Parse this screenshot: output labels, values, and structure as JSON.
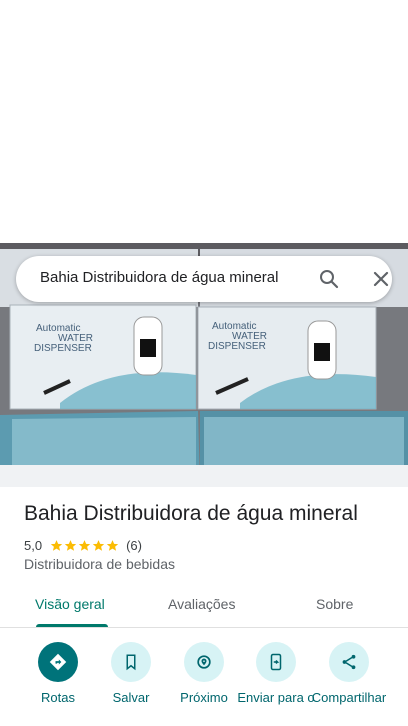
{
  "search": {
    "query": "Bahia Distribuidora de água mineral",
    "search_icon": "search-icon",
    "close_icon": "close-icon"
  },
  "photo": {
    "box_text_line1": "Automatic",
    "box_text_line2": "WATER",
    "box_text_line3": "DISPENSER"
  },
  "place": {
    "title": "Bahia Distribuidora de água mineral",
    "rating": "5,0",
    "stars": 5,
    "review_count": "(6)",
    "category": "Distribuidora de bebidas"
  },
  "tabs": [
    {
      "label": "Visão geral",
      "active": true
    },
    {
      "label": "Avaliações",
      "active": false
    },
    {
      "label": "Sobre",
      "active": false
    }
  ],
  "actions": [
    {
      "label": "Rotas",
      "icon": "directions-icon"
    },
    {
      "label": "Salvar",
      "icon": "bookmark-icon"
    },
    {
      "label": "Próximo",
      "icon": "nearby-icon"
    },
    {
      "label": "Enviar para o",
      "icon": "send-to-phone-icon"
    },
    {
      "label": "Compartilhar",
      "icon": "share-icon"
    }
  ],
  "colors": {
    "accent": "#00796b",
    "action_primary": "#00737a",
    "action_bg": "#d7f3f5",
    "star": "#fbbc04"
  }
}
